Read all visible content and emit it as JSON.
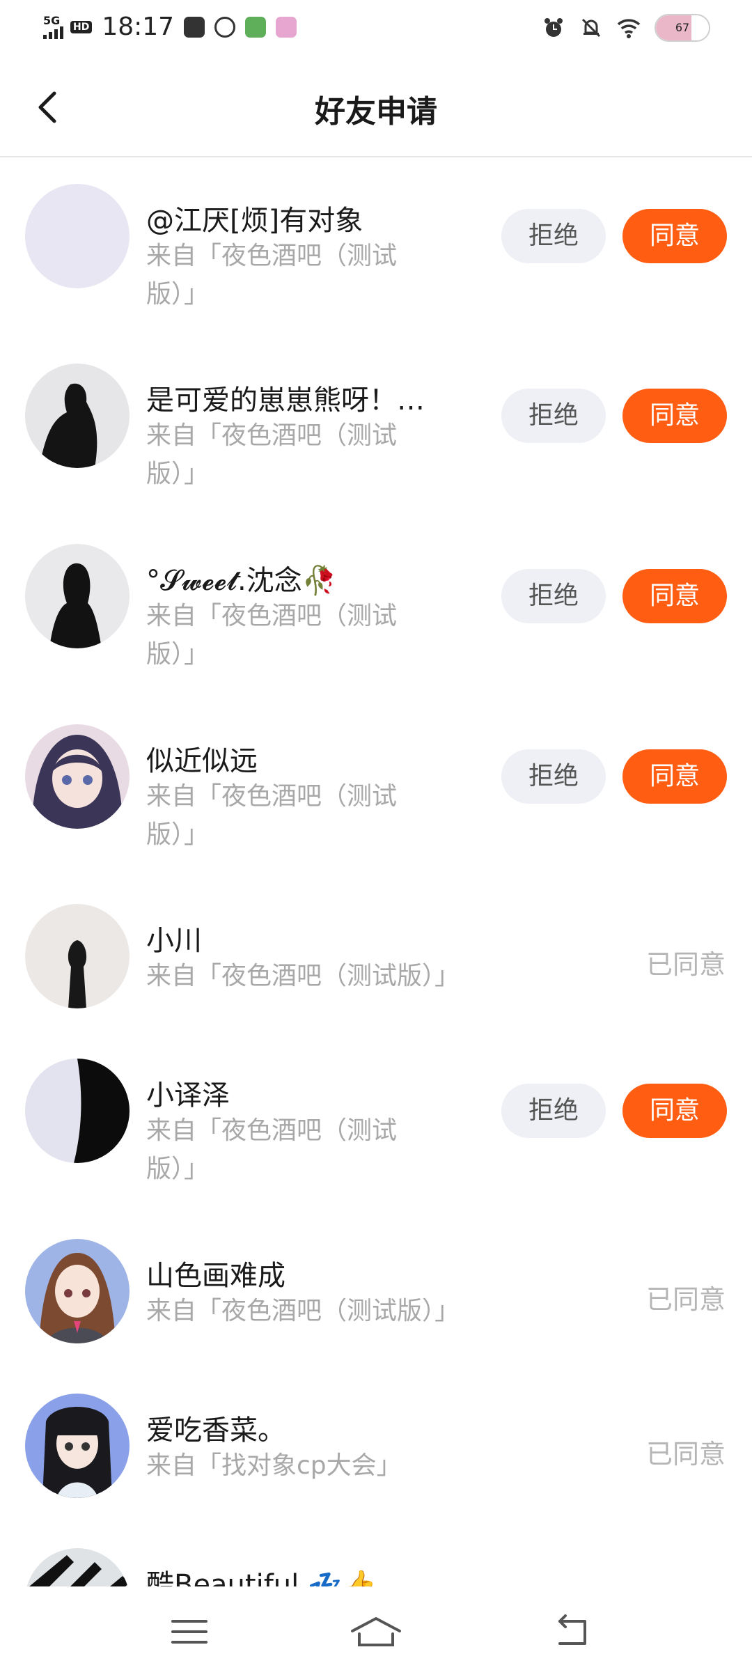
{
  "status_bar": {
    "network": "5G",
    "hd": "HD",
    "time": "18:17",
    "battery": "67",
    "battery_level": 0.67,
    "icons": [
      "message-icon",
      "at-icon",
      "app-icon-green",
      "app-icon-pink",
      "alarm-icon",
      "mute-bell-icon",
      "wifi-icon"
    ]
  },
  "header": {
    "title": "好友申请",
    "back_icon": "chevron-left-icon"
  },
  "colors": {
    "accent": "#ff5d12",
    "reject_bg": "#eef0f5",
    "secondary_text": "#a8a8a8"
  },
  "requests": [
    {
      "name": "@江厌[烦]有对象",
      "source": "来自「夜色酒吧（测试版）」",
      "reject_label": "拒绝",
      "accept_label": "同意"
    },
    {
      "name": "是可爱的崽崽熊呀！…",
      "source": "来自「夜色酒吧（测试版）」",
      "reject_label": "拒绝",
      "accept_label": "同意"
    },
    {
      "name": "°𝓢𝔀𝓮𝓮𝓽.沈念🥀",
      "source": "来自「夜色酒吧（测试版）」",
      "reject_label": "拒绝",
      "accept_label": "同意"
    },
    {
      "name": "似近似远",
      "source": "来自「夜色酒吧（测试版）」",
      "reject_label": "拒绝",
      "accept_label": "同意"
    },
    {
      "name": "小川",
      "source": "来自「夜色酒吧（测试版）」",
      "status": "已同意"
    },
    {
      "name": "小译泽",
      "source": "来自「夜色酒吧（测试版）」",
      "reject_label": "拒绝",
      "accept_label": "同意"
    },
    {
      "name": "山色画难成",
      "source": "来自「夜色酒吧（测试版）」",
      "status": "已同意"
    },
    {
      "name": "爱吃香菜。",
      "source": "来自「找对象cp大会」",
      "status": "已同意"
    },
    {
      "name": "酷Beautiful 💤👍"
    }
  ],
  "nav_bar": {
    "icons": [
      "menu-icon",
      "home-icon",
      "back-icon"
    ]
  }
}
